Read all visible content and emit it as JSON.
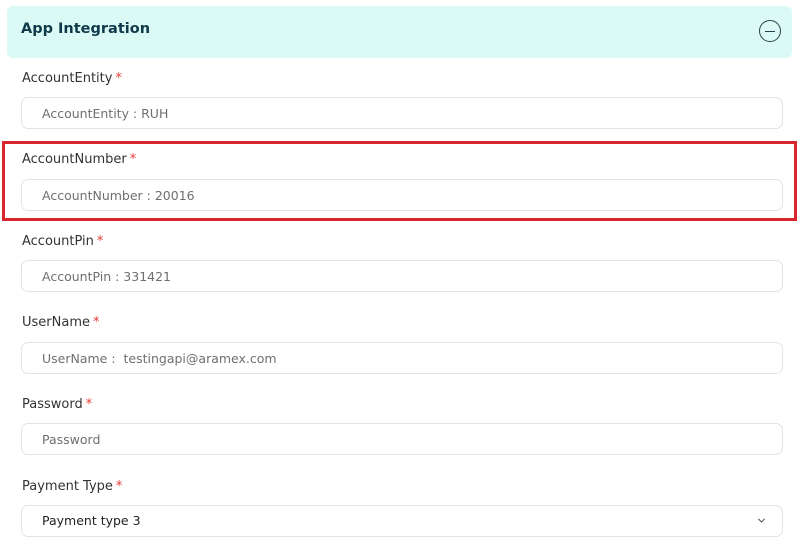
{
  "panel": {
    "title": "App Integration"
  },
  "required_marker": "*",
  "fields": [
    {
      "label": "AccountEntity",
      "placeholder": "AccountEntity : RUH"
    },
    {
      "label": "AccountNumber",
      "placeholder": "AccountNumber : 20016"
    },
    {
      "label": "AccountPin",
      "placeholder": "AccountPin : 331421"
    },
    {
      "label": "UserName",
      "placeholder": "UserName :  testingapi@aramex.com"
    },
    {
      "label": "Password",
      "placeholder": "Password"
    }
  ],
  "payment": {
    "label": "Payment Type",
    "selected": "Payment type 3"
  },
  "colors": {
    "header_bg": "#dbfaf5",
    "required": "#e53935",
    "highlight": "#d8262d"
  },
  "icons": {
    "collapse": "minus-circle-icon",
    "dropdown": "chevron-down-icon"
  }
}
